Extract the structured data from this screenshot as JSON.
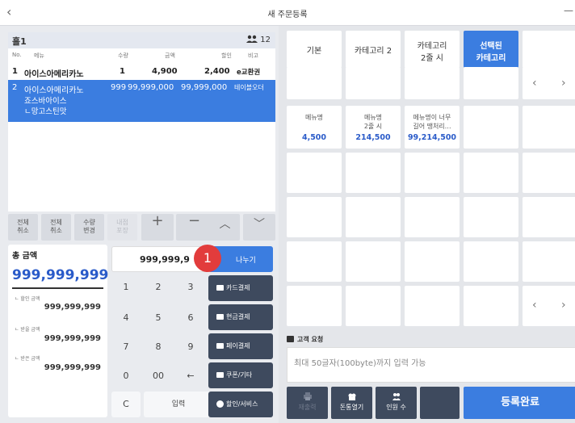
{
  "window": {
    "title": "새 주문등록",
    "back": "‹",
    "minimize": "—"
  },
  "order": {
    "table_name": "홀1",
    "guest_count": "12",
    "columns": [
      "No.",
      "메뉴",
      "수량",
      "금액",
      "할인",
      "비고"
    ],
    "rows": [
      {
        "no": "1",
        "menu": "아이스아메리카노",
        "qty": "1",
        "amount": "4,900",
        "discount": "2,400",
        "note": "e교환권",
        "options": []
      },
      {
        "no": "2",
        "menu": "아이스아메리카노",
        "qty": "999",
        "amount": "99,999,000",
        "discount": "99,999,000",
        "note": "테이블오더",
        "options": [
          "죠스바아이스",
          "ㄴ망고스틴맛"
        ]
      }
    ]
  },
  "function_keys": {
    "cancel_all": [
      "전체",
      "취소"
    ],
    "cancel_selected": [
      "전체",
      "취소"
    ],
    "change_qty": [
      "수량",
      "변경"
    ],
    "dine_pack": [
      "내점",
      "포장"
    ],
    "plus": "+",
    "minus": "−",
    "up": "︿",
    "down": "﹀"
  },
  "totals": {
    "total_label": "총 금액",
    "total_value": "999,999,999",
    "discount_label": "ㄴ 할인 금액",
    "discount_value": "999,999,999",
    "receivable_label": "ㄴ 받을 금액",
    "receivable_value": "999,999,999",
    "received_label": "ㄴ 받은 금액",
    "received_value": "999,999,999"
  },
  "keypad": {
    "display_value": "999,999,9",
    "badge": "1",
    "split_label": "나누기",
    "keys": [
      "1",
      "2",
      "3",
      "4",
      "5",
      "6",
      "7",
      "8",
      "9",
      "0",
      "00",
      "←"
    ],
    "clear": "C",
    "enter": "입력"
  },
  "payments": [
    "카드결제",
    "현금결제",
    "페이결제",
    "쿠폰/기타",
    "할인/서비스"
  ],
  "categories": {
    "tabs": [
      {
        "label": "기본"
      },
      {
        "label": "카테고리 2"
      },
      {
        "label": "카테고리",
        "label2": "2줄 시"
      },
      {
        "label": "선택된",
        "label2": "카테고리"
      }
    ],
    "prev": "‹",
    "next": "›"
  },
  "menus": [
    {
      "name": "메뉴명",
      "name2": "",
      "price": "4,500"
    },
    {
      "name": "메뉴명",
      "name2": "2줄 시",
      "price": "214,500"
    },
    {
      "name": "메뉴명이 너무",
      "name2": "길어 땡처리…",
      "price": "99,214,500"
    }
  ],
  "customer_request": {
    "label": "고객 요청",
    "placeholder": "최대 50글자(100byte)까지 입력 가능"
  },
  "bottom": {
    "resend": "재출력",
    "drawer": "돈통열기",
    "guests": "인원 수",
    "submit": "등록완료"
  },
  "colors": {
    "accent": "#3b7de0",
    "dark_button": "#3e4a5e",
    "badge": "#e23c3c"
  }
}
